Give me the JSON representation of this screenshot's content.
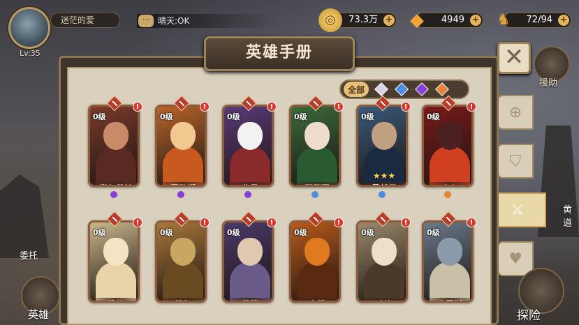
{
  "player": {
    "name": "迷茫的爱",
    "level": "Lv:35"
  },
  "chat": {
    "message": "晴天:OK"
  },
  "resources": [
    {
      "name": "gold",
      "value": "73.3万",
      "icon": "gold-coin-icon",
      "color": "#e8b84c"
    },
    {
      "name": "diamond",
      "value": "4949",
      "icon": "diamond-icon",
      "color": "#f2a63a"
    },
    {
      "name": "stamina",
      "value": "72/94",
      "icon": "stamina-icon",
      "color": "#e2a241"
    }
  ],
  "panel": {
    "title": "英雄手册"
  },
  "filters": [
    {
      "label": "全部",
      "active": true
    },
    {
      "label": "",
      "icon": "white-diamond-icon",
      "color": "#d9d3e6"
    },
    {
      "label": "",
      "icon": "blue-diamond-icon",
      "color": "#4d8de0"
    },
    {
      "label": "",
      "icon": "purple-diamond-icon",
      "color": "#8a3fd8"
    },
    {
      "label": "",
      "icon": "orange-diamond-icon",
      "color": "#e8823a"
    }
  ],
  "heroes": [
    {
      "name": "塞尔凯特",
      "level": "0级",
      "faction_color": "#8a3fd8",
      "bg": "#7a3a2a",
      "skin": "#c98a6a",
      "cloth": "#5a2a22",
      "stars": ""
    },
    {
      "name": "蕾欧娜",
      "level": "0级",
      "faction_color": "#8a3fd8",
      "bg": "#b8642a",
      "skin": "#f0c890",
      "cloth": "#c85a20",
      "stars": ""
    },
    {
      "name": "北风",
      "level": "0级",
      "faction_color": "#8a3fd8",
      "bg": "#5a3a7a",
      "skin": "#f2f2f2",
      "cloth": "#8a2a2a",
      "stars": ""
    },
    {
      "name": "西莉亚",
      "level": "0级",
      "faction_color": "#4d8de0",
      "bg": "#3a6a3a",
      "skin": "#f0dccc",
      "cloth": "#2a5a30",
      "stars": ""
    },
    {
      "name": "黑胡子",
      "level": "0级",
      "faction_color": "#4d8de0",
      "bg": "#3a5a7a",
      "skin": "#c0a080",
      "cloth": "#1a2a40",
      "stars": "★★★"
    },
    {
      "name": "炎心",
      "level": "0级",
      "faction_color": "#e8823a",
      "bg": "#7a1a1a",
      "skin": "#4a2020",
      "cloth": "#d04020",
      "stars": ""
    },
    {
      "name": "瞻格",
      "level": "0级",
      "faction_color": "",
      "bg": "#c9b68a",
      "skin": "#f4e4c4",
      "cloth": "#e8d4a8",
      "stars": ""
    },
    {
      "name": "祖尔",
      "level": "0级",
      "faction_color": "",
      "bg": "#a8783a",
      "skin": "#c8a860",
      "cloth": "#6a4a20",
      "stars": ""
    },
    {
      "name": "菲莉",
      "level": "0级",
      "faction_color": "",
      "bg": "#4a3a6a",
      "skin": "#e0c8b0",
      "cloth": "#6a5a8a",
      "stars": ""
    },
    {
      "name": "森德",
      "level": "0级",
      "faction_color": "",
      "bg": "#b85a1a",
      "skin": "#e07a20",
      "cloth": "#5a2a10",
      "stars": ""
    },
    {
      "name": "哈比",
      "level": "0级",
      "faction_color": "",
      "bg": "#9a8a6a",
      "skin": "#ece0c8",
      "cloth": "#4a3a2a",
      "stars": ""
    },
    {
      "name": "克里斯",
      "level": "0级",
      "faction_color": "",
      "bg": "#6a7a8a",
      "skin": "#8a9aaa",
      "cloth": "#c9c0a8",
      "stars": ""
    }
  ],
  "side": {
    "help": "援助",
    "huang": "黄道",
    "delegate": "委托",
    "heroes": "英雄",
    "explore": "探险"
  }
}
